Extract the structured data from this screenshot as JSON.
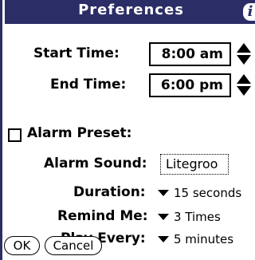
{
  "window": {
    "title": "Preferences",
    "info_icon_glyph": "i"
  },
  "start_time": {
    "label": "Start Time:",
    "value": "8:00 am"
  },
  "end_time": {
    "label": "End Time:",
    "value": "6:00 pm"
  },
  "alarm_preset": {
    "label": "Alarm Preset:",
    "checked": false
  },
  "alarm_sound": {
    "label": "Alarm Sound:",
    "value": "Litegroo"
  },
  "duration": {
    "label": "Duration:",
    "value": "15 seconds"
  },
  "remind_me": {
    "label": "Remind Me:",
    "value": "3 Times"
  },
  "play_every": {
    "label": "Play Every:",
    "value": "5 minutes"
  },
  "buttons": {
    "ok": "OK",
    "cancel": "Cancel"
  },
  "colors": {
    "titlebar": "#2b2d66",
    "background": "#ffffff"
  }
}
